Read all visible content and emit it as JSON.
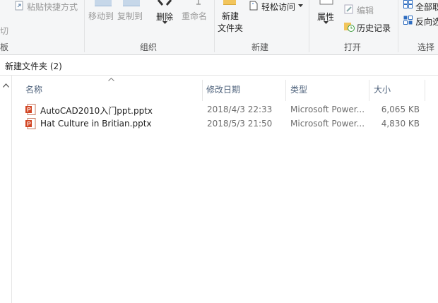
{
  "ribbon": {
    "clipboard": {
      "paste_shortcut": "粘贴快捷方式",
      "cut_partial": "切",
      "group_partial": "板"
    },
    "organize": {
      "move_to": "移动到",
      "copy_to": "复制到",
      "delete": "删除",
      "rename": "重命名",
      "group": "组织"
    },
    "new": {
      "new_folder_line1": "新建",
      "new_folder_line2": "文件夹",
      "easy_access": "轻松访问",
      "group": "新建"
    },
    "open": {
      "properties": "属性",
      "edit": "编辑",
      "history": "历史记录",
      "group": "打开"
    },
    "select": {
      "select_all_partial": "全部取",
      "invert_partial": "反向选",
      "group": "选择"
    }
  },
  "address": {
    "text": "新建文件夹 (2)"
  },
  "columns": {
    "name": "名称",
    "date": "修改日期",
    "type": "类型",
    "size": "大小"
  },
  "files": [
    {
      "name": "AutoCAD2010入门ppt.pptx",
      "date": "2018/4/3 22:33",
      "type": "Microsoft Power...",
      "size": "6,065 KB"
    },
    {
      "name": "Hat Culture in Britian.pptx",
      "date": "2018/5/3 21:50",
      "type": "Microsoft Power...",
      "size": "4,830 KB"
    }
  ],
  "icons": [
    "paste-shortcut-icon",
    "move-to-icon",
    "copy-to-icon",
    "delete-icon",
    "rename-icon",
    "new-folder-icon",
    "easy-access-icon",
    "properties-icon",
    "edit-icon",
    "history-icon",
    "select-all-icon",
    "invert-selection-icon",
    "pptx-file-icon",
    "sort-up-icon",
    "scroll-up-icon"
  ],
  "colors": {
    "ribbon_bg": "#f5f6f7",
    "ppt_orange": "#d24726",
    "header_text": "#4c607a"
  }
}
